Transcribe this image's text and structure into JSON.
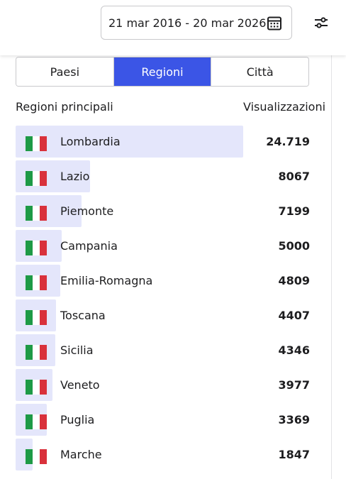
{
  "header": {
    "date_range": "21 mar 2016 - 20 mar 2026",
    "calendar_icon": "calendar-icon",
    "filter_icon": "sliders-icon"
  },
  "tabs": [
    {
      "label": "Paesi",
      "active": false
    },
    {
      "label": "Regioni",
      "active": true
    },
    {
      "label": "Città",
      "active": false
    }
  ],
  "table": {
    "col_left": "Regioni principali",
    "col_right": "Visualizzazioni",
    "rows": [
      {
        "name": "Lombardia",
        "value": "24.719",
        "share": 1.0
      },
      {
        "name": "Lazio",
        "value": "8067",
        "share": 0.326
      },
      {
        "name": "Piemonte",
        "value": "7199",
        "share": 0.291
      },
      {
        "name": "Campania",
        "value": "5000",
        "share": 0.202
      },
      {
        "name": "Emilia-Romagna",
        "value": "4809",
        "share": 0.195
      },
      {
        "name": "Toscana",
        "value": "4407",
        "share": 0.178
      },
      {
        "name": "Sicilia",
        "value": "4346",
        "share": 0.176
      },
      {
        "name": "Veneto",
        "value": "3977",
        "share": 0.161
      },
      {
        "name": "Puglia",
        "value": "3369",
        "share": 0.136
      },
      {
        "name": "Marche",
        "value": "1847",
        "share": 0.075
      }
    ],
    "flag_icon": "italy-flag-icon"
  },
  "colors": {
    "accent": "#3b55e6",
    "bar": "#e4e6fb",
    "flag_green": "#1e9a46",
    "flag_white": "#ffffff",
    "flag_red": "#d9313b"
  }
}
